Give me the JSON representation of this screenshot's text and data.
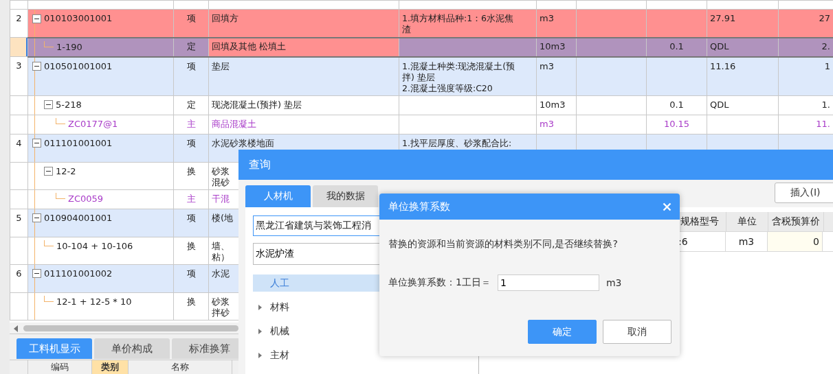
{
  "table": {
    "rows": [
      {
        "kind": "bill",
        "num": "2",
        "code": "010103001001",
        "type": "项",
        "name": [
          "回填方"
        ],
        "description": [
          "1.填方材料品种:1：6水泥焦",
          "渣"
        ],
        "unit": "m3",
        "column_9": "27.91",
        "column_10": "27",
        "flagged": true,
        "selected": false,
        "expanded": true,
        "children": [
          {
            "kind": "quota",
            "code": "1-190",
            "type": "定",
            "name": [
              "回填及其他 松填土"
            ],
            "unit": "10m3",
            "quantity": "0.1",
            "column_9": "QDL",
            "column_10": "2.",
            "flagged": true,
            "selected": true
          }
        ]
      },
      {
        "kind": "bill",
        "num": "3",
        "code": "010501001001",
        "type": "项",
        "name": [
          "垫层"
        ],
        "description": [
          "1.混凝土种类:现浇混凝土(预",
          "拌) 垫层",
          "2.混凝土强度等级:C20"
        ],
        "unit": "m3",
        "column_9": "11.16",
        "column_10": "1",
        "flagged": false,
        "selected": false,
        "expanded": true,
        "children": [
          {
            "kind": "quota",
            "code": "5-218",
            "type": "定",
            "name": [
              "现浇混凝土(预拌) 垫层"
            ],
            "unit": "10m3",
            "quantity": "0.1",
            "column_9": "QDL",
            "column_10": "1.",
            "flagged": false,
            "selected": false,
            "expanded": true,
            "children": [
              {
                "kind": "material",
                "code": "ZC0177@1",
                "type": "主",
                "name": [
                  "商品混凝土"
                ],
                "unit": "m3",
                "quantity": "10.15",
                "column_10": "11.",
                "flagged": false,
                "selected": false
              }
            ]
          }
        ]
      },
      {
        "kind": "bill",
        "num": "4",
        "code": "011101001001",
        "type": "项",
        "name": [
          "水泥砂浆楼地面"
        ],
        "description": [
          "1.找平层厚度、砂浆配合比:"
        ],
        "flagged": false,
        "selected": false,
        "expanded": true,
        "children": [
          {
            "kind": "quota",
            "code": "12-2",
            "type": "换",
            "name": [
              "砂浆",
              "混砂"
            ],
            "flagged": false,
            "selected": false,
            "expanded": true,
            "children": [
              {
                "kind": "material",
                "code": "ZC0059",
                "type": "主",
                "name": [
                  "干混"
                ],
                "flagged": false,
                "selected": false
              }
            ]
          }
        ]
      },
      {
        "kind": "bill",
        "num": "5",
        "code": "010904001001",
        "type": "项",
        "name": [
          "楼(地"
        ],
        "flagged": false,
        "selected": false,
        "expanded": true,
        "children": [
          {
            "kind": "quota",
            "code": "10-104 + 10-106",
            "type": "换",
            "name": [
              "墙、",
              "粘）"
            ],
            "flagged": false,
            "selected": false
          }
        ]
      },
      {
        "kind": "bill",
        "num": "6",
        "code": "011101001002",
        "type": "项",
        "name": [
          "水泥"
        ],
        "flagged": false,
        "selected": false,
        "expanded": true,
        "children": [
          {
            "kind": "quota",
            "code": "12-1 + 12-5 * 10",
            "type": "换",
            "name": [
              "砂浆",
              "拌砂"
            ],
            "flagged": false,
            "selected": false
          }
        ]
      }
    ]
  },
  "bottom_panel": {
    "tabs": [
      {
        "label": "工料机显示",
        "selected": true
      },
      {
        "label": "单价构成",
        "selected": false
      },
      {
        "label": "标准换算",
        "selected": false
      }
    ],
    "columns": [
      {
        "label": "编码",
        "selected": false
      },
      {
        "label": "类别",
        "selected": true
      },
      {
        "label": "名称",
        "selected": false
      }
    ]
  },
  "query_dialog": {
    "title": "查询",
    "tabs": [
      {
        "label": "人材机",
        "selected": true
      },
      {
        "label": "我的数据",
        "selected": false
      }
    ],
    "library_select": "黑龙江省建筑与装饰工程消",
    "search": {
      "value": "水泥炉渣"
    },
    "tree": [
      {
        "label": "人工",
        "selected": true,
        "expandable": false
      },
      {
        "label": "材料",
        "selected": false,
        "expandable": true
      },
      {
        "label": "机械",
        "selected": false,
        "expandable": true
      },
      {
        "label": "主材",
        "selected": false,
        "expandable": true
      }
    ],
    "insert_button": "插入(I)",
    "table": {
      "columns": [
        "规格型号",
        "单位",
        "含税预算价"
      ],
      "rows": [
        [
          ":6",
          "m3",
          "0"
        ]
      ]
    }
  },
  "conversion_dialog": {
    "title": "单位换算系数",
    "message": "替换的资源和当前资源的材料类别不同,是否继续替换?",
    "factor_label": "单位换算系数：1工日＝",
    "factor_value": "1",
    "factor_unit": "m3",
    "buttons": [
      {
        "label": "确定",
        "kind": "primary"
      },
      {
        "label": "取消",
        "kind": "secondary"
      }
    ]
  }
}
